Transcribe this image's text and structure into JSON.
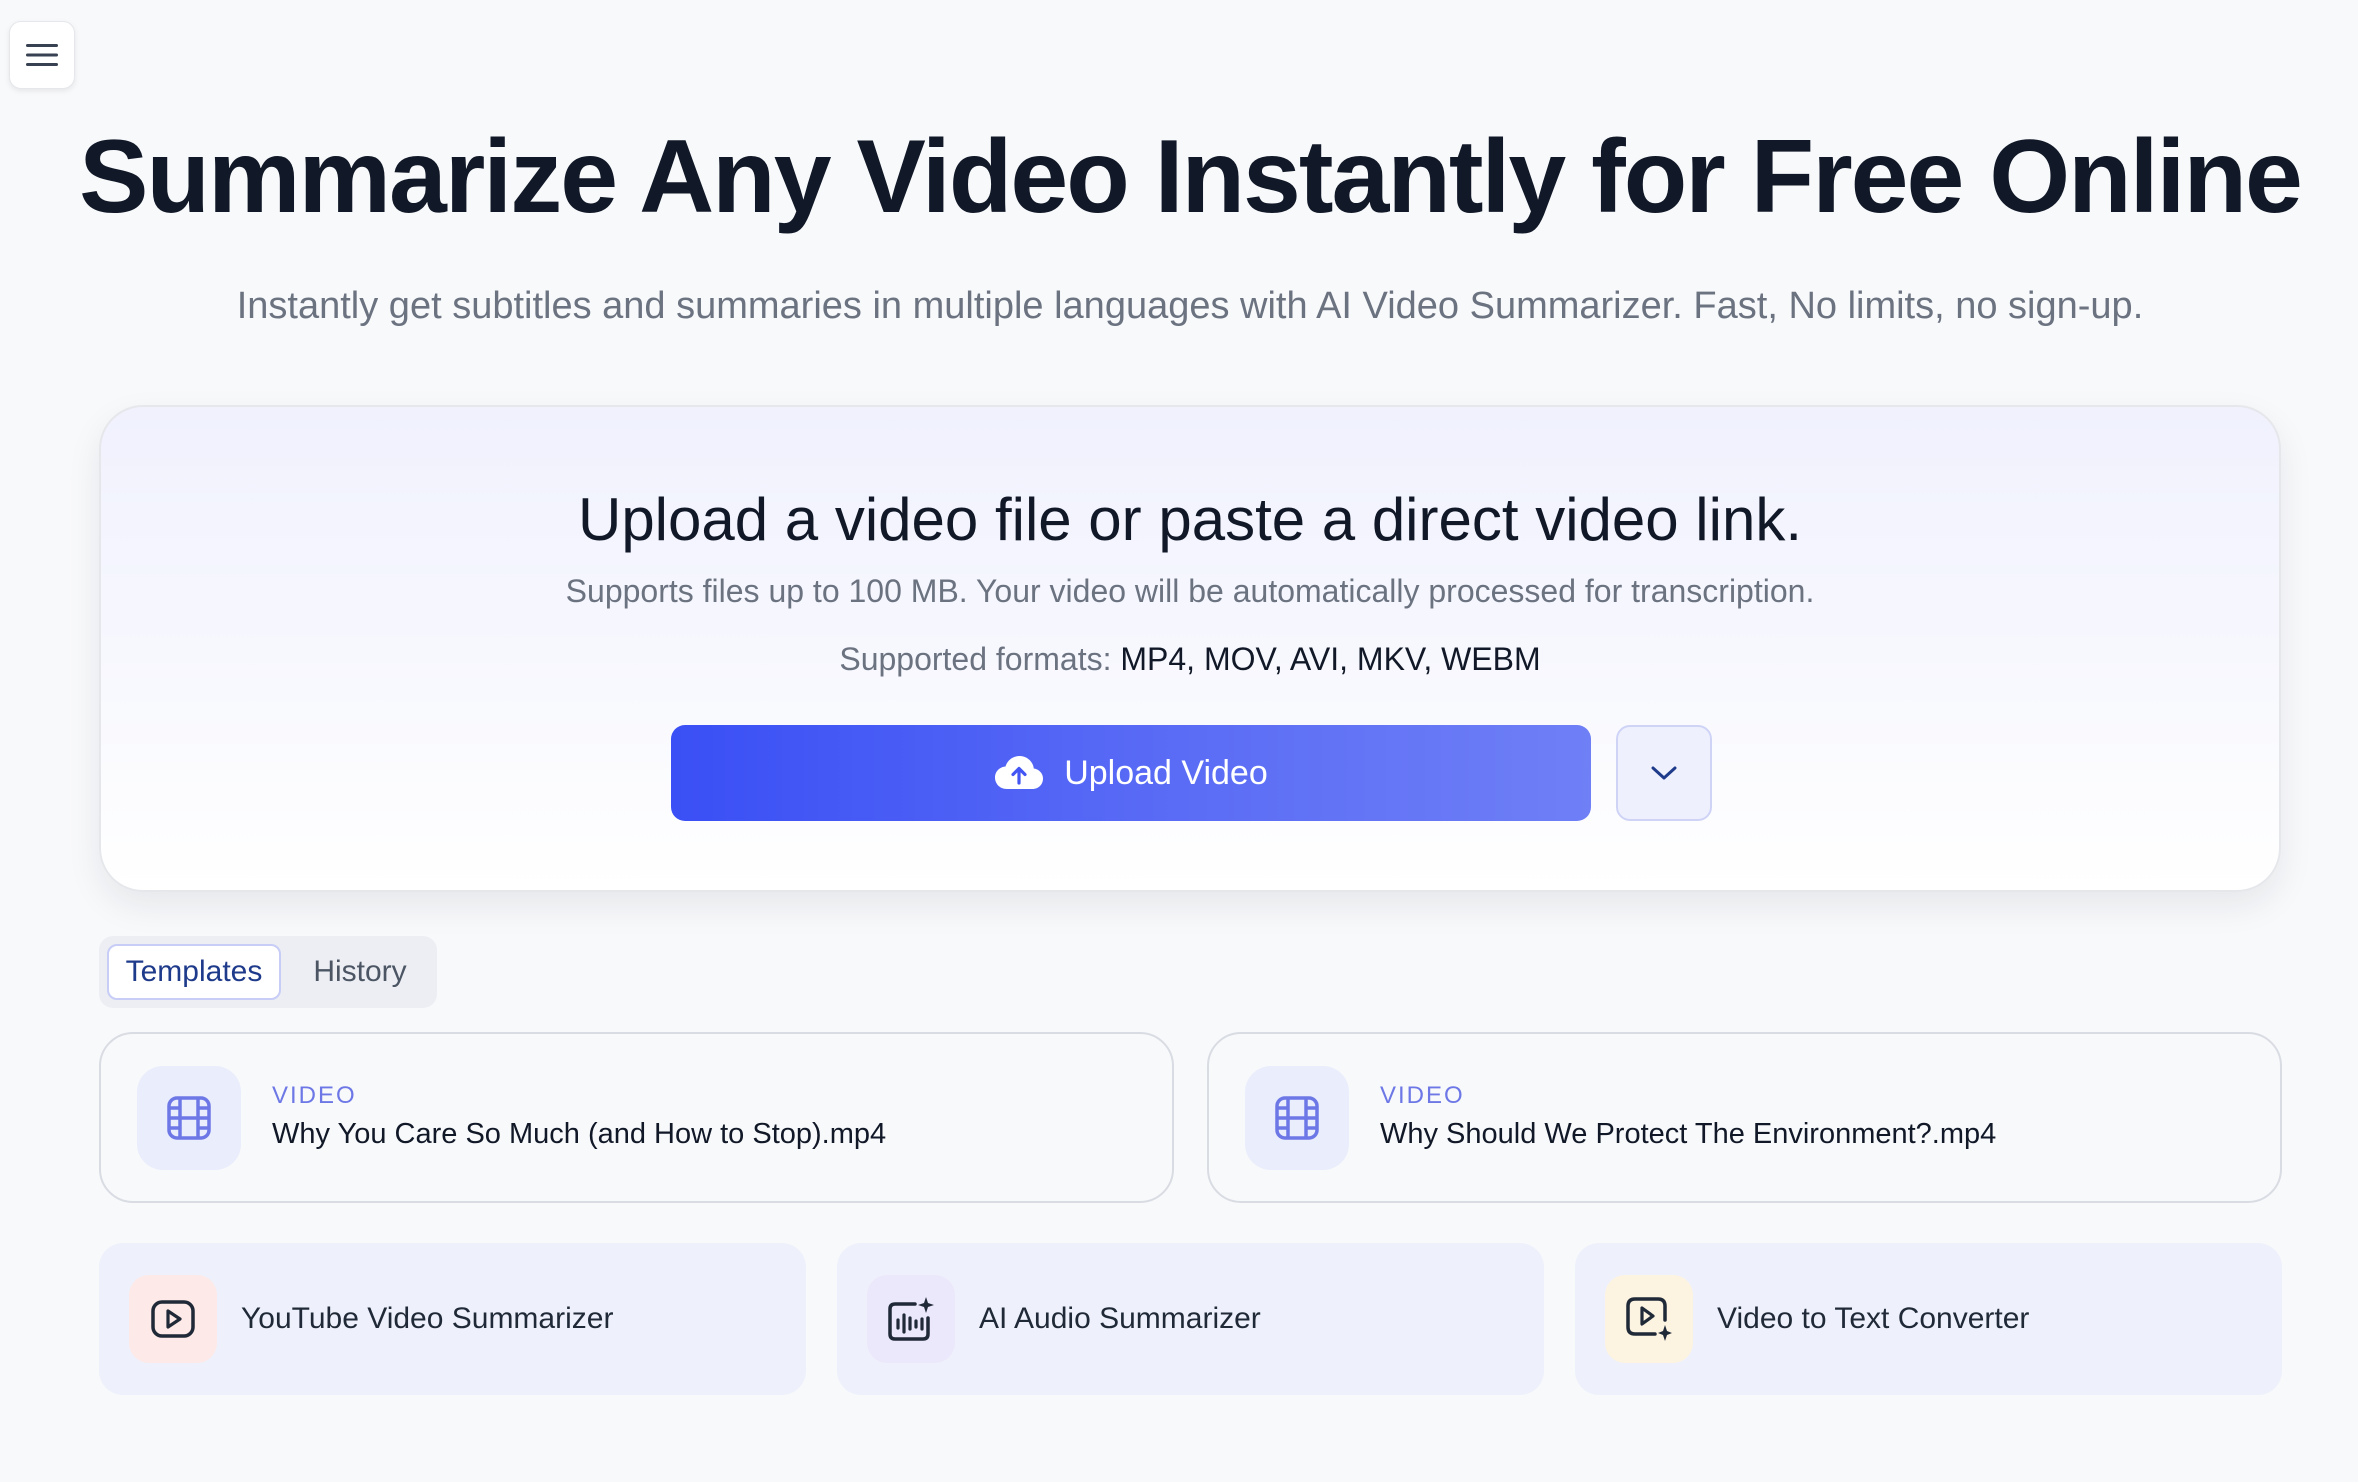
{
  "menu": {
    "icon": "hamburger-menu-icon"
  },
  "hero": {
    "title": "Summarize Any Video Instantly for Free Online",
    "subtitle": "Instantly get subtitles and summaries in multiple languages with AI Video Summarizer. Fast, No limits, no sign-up."
  },
  "upload_card": {
    "title": "Upload a video file or paste a direct video link.",
    "description": "Supports files up to 100 MB. Your video will be automatically processed for transcription.",
    "formats_label": "Supported formats:",
    "formats_list": "MP4, MOV, AVI, MKV, WEBM",
    "upload_button_label": "Upload Video",
    "upload_button_icon": "cloud-upload-icon",
    "dropdown_icon": "chevron-down-icon",
    "accent_color": "#3a4ff5"
  },
  "tabs": [
    {
      "label": "Templates",
      "active": true
    },
    {
      "label": "History",
      "active": false
    }
  ],
  "files": [
    {
      "type": "VIDEO",
      "name": "Why You Care So Much (and How to Stop).mp4",
      "icon": "film-icon"
    },
    {
      "type": "VIDEO",
      "name": "Why Should We Protect The Environment?.mp4",
      "icon": "film-icon"
    }
  ],
  "tools": [
    {
      "label": "YouTube Video Summarizer",
      "icon": "youtube-play-icon",
      "icon_bg": "#fde9e7"
    },
    {
      "label": "AI Audio Summarizer",
      "icon": "audio-sparkle-icon",
      "icon_bg": "#ece8fb"
    },
    {
      "label": "Video to Text Converter",
      "icon": "video-text-icon",
      "icon_bg": "#fdf3e1"
    }
  ]
}
